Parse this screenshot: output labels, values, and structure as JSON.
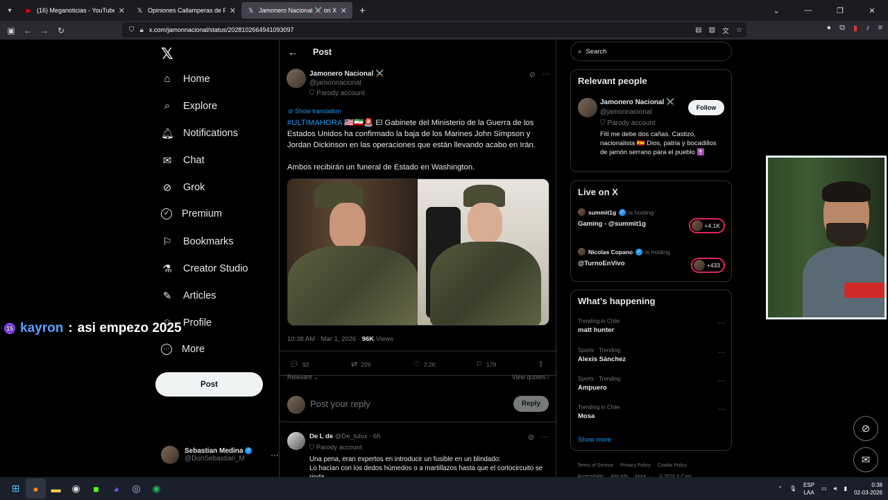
{
  "browser": {
    "tabs": [
      {
        "title": "(16) Meganoticias - YouTube",
        "icon": "youtube-icon",
        "active": false
      },
      {
        "title": "Opiniones Callamperas de Polití",
        "icon": "x-icon",
        "active": false
      },
      {
        "title": "Jamonero Nacional ⚔️ on X: \"#",
        "icon": "x-icon",
        "active": true
      }
    ],
    "url": "x.com/jamonnacional/status/2028102664941093097"
  },
  "nav": {
    "items": [
      {
        "label": "Home",
        "icon": "home-icon",
        "glyph": "⌂"
      },
      {
        "label": "Explore",
        "icon": "search-icon",
        "glyph": "⌕"
      },
      {
        "label": "Notifications",
        "icon": "bell-icon",
        "glyph": "⍾"
      },
      {
        "label": "Chat",
        "icon": "mail-icon",
        "glyph": "✉"
      },
      {
        "label": "Grok",
        "icon": "grok-icon",
        "glyph": "⊘"
      },
      {
        "label": "Premium",
        "icon": "premium-icon",
        "glyph": "✓"
      },
      {
        "label": "Bookmarks",
        "icon": "bookmark-icon",
        "glyph": "⚑"
      },
      {
        "label": "Creator Studio",
        "icon": "flask-icon",
        "glyph": "⚗"
      },
      {
        "label": "Articles",
        "icon": "articles-icon",
        "glyph": "✎"
      },
      {
        "label": "Profile",
        "icon": "profile-icon",
        "glyph": "☺"
      },
      {
        "label": "More",
        "icon": "more-icon",
        "glyph": "⋯"
      }
    ],
    "post_button": "Post",
    "account": {
      "name": "Sebastian Medina",
      "handle": "@DonSebastian_M"
    }
  },
  "chat_overlay": {
    "badge": "15",
    "user": "kayron",
    "separator": ":",
    "message": "asi empezo 2025"
  },
  "post": {
    "header_title": "Post",
    "author_name": "Jamonero Nacional ⚔️",
    "author_handle": "@jamonnacional",
    "parody_label": "Parody account",
    "show_translation": "Show translation",
    "hashtag": "#ULTIMAHORA",
    "flags": "🇺🇸🇮🇷🚨",
    "text1": "El Gabinete del Ministerio de la Guerra de los Estados Unidos ha confirmado la baja de los Marines John Simpson y Jordan Dickinson en las operaciones que están llevando acabo en Irán.",
    "text2": "Ambos recibirán un funeral de Estado en Washington.",
    "timestamp": "10:38 AM · Mar 1, 2026 · ",
    "views_count": "96K",
    "views_label": " Views",
    "replies": "92",
    "reposts": "229",
    "likes": "2.2K",
    "bookmarks": "179",
    "sort_label": "Relevant",
    "view_quotes": "View quotes",
    "reply_placeholder": "Post your reply",
    "reply_button": "Reply"
  },
  "first_reply": {
    "name": "De L de",
    "handle": "@De_lulux",
    "time": "· 6h",
    "parody_label": "Parody account",
    "line1": "Una pena, eran expertos en introducir un fusible en un blindado:",
    "line2": "Lo hacían con los dedos húmedos o a martillazos hasta que el cortocircuito se rinda."
  },
  "sidebar": {
    "search_placeholder": "Search",
    "relevant_title": "Relevant people",
    "relevant_person": {
      "name": "Jamonero Nacional ⚔️",
      "handle": "@jamonnacional",
      "parody": "Parody account",
      "bio": "Fiti me debe dos cañas. Castizo, nacionalista 🇪🇸 Dios, patria y bocadillos de jamón serrano para el pueblo ✝️",
      "follow": "Follow"
    },
    "live_title": "Live on X",
    "live": [
      {
        "host": "summit1g",
        "hosting": "is hosting",
        "title": "Gaming - @summit1g",
        "count": "+4.1K"
      },
      {
        "host": "Nicolas Copano",
        "hosting": "is hosting",
        "title": "@TurnoEnVivo",
        "count": "+433"
      }
    ],
    "happening_title": "What’s happening",
    "trends": [
      {
        "category": "Trending in Chile",
        "title": "matt hunter"
      },
      {
        "category": "Sports · Trending",
        "title": "Alexis Sánchez"
      },
      {
        "category": "Sports · Trending",
        "title": "Ampuero"
      },
      {
        "category": "Trending in Chile",
        "title": "Mosa"
      }
    ],
    "show_more": "Show more",
    "footer": [
      "Terms of Service",
      "Privacy Policy",
      "Cookie Policy",
      "Accessibility",
      "Ads info",
      "More ···",
      "© 2026 X Corp."
    ]
  },
  "taskbar": {
    "lang1": "ESP",
    "lang2": "LAA",
    "time": "0:38",
    "date": "02-03-2026"
  }
}
